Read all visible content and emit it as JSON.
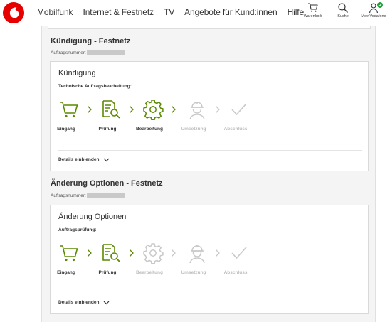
{
  "header": {
    "logo_icon": "vodafone-speechmark-icon",
    "nav": [
      "Mobilfunk",
      "Internet & Festnetz",
      "TV",
      "Angebote für Kund:innen",
      "Hilfe"
    ],
    "tools": {
      "cart_label": "Warenkorb",
      "search_label": "Suche",
      "account_label": "MeinVodafone"
    }
  },
  "colors": {
    "brand": "#e60000",
    "active_green": "#5a8a00",
    "inactive": "#c8c8c8",
    "badge": "#22a33a"
  },
  "orders": [
    {
      "section_title": "Kündigung - Festnetz",
      "order_label": "Auftragsnummer:",
      "card_title": "Kündigung",
      "status_label": "Technische Auftragsbearbeitung:",
      "steps": [
        {
          "label": "Eingang",
          "icon": "cart-icon",
          "active": true
        },
        {
          "label": "Prüfung",
          "icon": "document-search-icon",
          "active": true
        },
        {
          "label": "Bearbeitung",
          "icon": "gear-icon",
          "active": true
        },
        {
          "label": "Umsetzung",
          "icon": "technician-icon",
          "active": false
        },
        {
          "label": "Abschluss",
          "icon": "checkmark-icon",
          "active": false
        }
      ],
      "details_label": "Details einblenden"
    },
    {
      "section_title": "Änderung Optionen - Festnetz",
      "order_label": "Auftragsnummer:",
      "card_title": "Änderung Optionen",
      "status_label": "Auftragsprüfung:",
      "steps": [
        {
          "label": "Eingang",
          "icon": "cart-icon",
          "active": true
        },
        {
          "label": "Prüfung",
          "icon": "document-search-icon",
          "active": true
        },
        {
          "label": "Bearbeitung",
          "icon": "gear-icon",
          "active": false
        },
        {
          "label": "Umsetzung",
          "icon": "technician-icon",
          "active": false
        },
        {
          "label": "Abschluss",
          "icon": "checkmark-icon",
          "active": false
        }
      ],
      "details_label": "Details einblenden"
    }
  ]
}
